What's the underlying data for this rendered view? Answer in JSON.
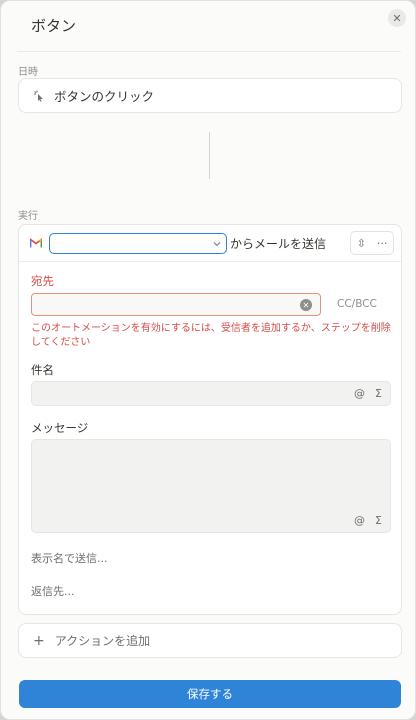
{
  "header": {
    "title": "ボタン",
    "close_icon": "close-icon"
  },
  "trigger": {
    "section_label": "日時",
    "icon": "click-cursor-icon",
    "label": "ボタンのクリック"
  },
  "action": {
    "section_label": "実行",
    "service_icon": "gmail-icon",
    "account_value": "",
    "send_from_label": "からメールを送信",
    "tools_icons": [
      "collapse-icon",
      "more-icon"
    ],
    "to": {
      "label": "宛先",
      "value": "",
      "cc_bcc": "CC/BCC"
    },
    "error": "このオートメーションを有効にするには、受信者を追加するか、ステップを削除してください",
    "subject": {
      "label": "件名",
      "value": ""
    },
    "message": {
      "label": "メッセージ",
      "value": ""
    },
    "input_tool_glyphs": [
      "@",
      "Σ"
    ],
    "send_as_label": "表示名で送信...",
    "reply_to_label": "返信先..."
  },
  "add_action": {
    "label": "アクションを追加"
  },
  "save_button": {
    "label": "保存する"
  },
  "colors": {
    "accent": "#2f84d8",
    "error": "#d44c47"
  }
}
